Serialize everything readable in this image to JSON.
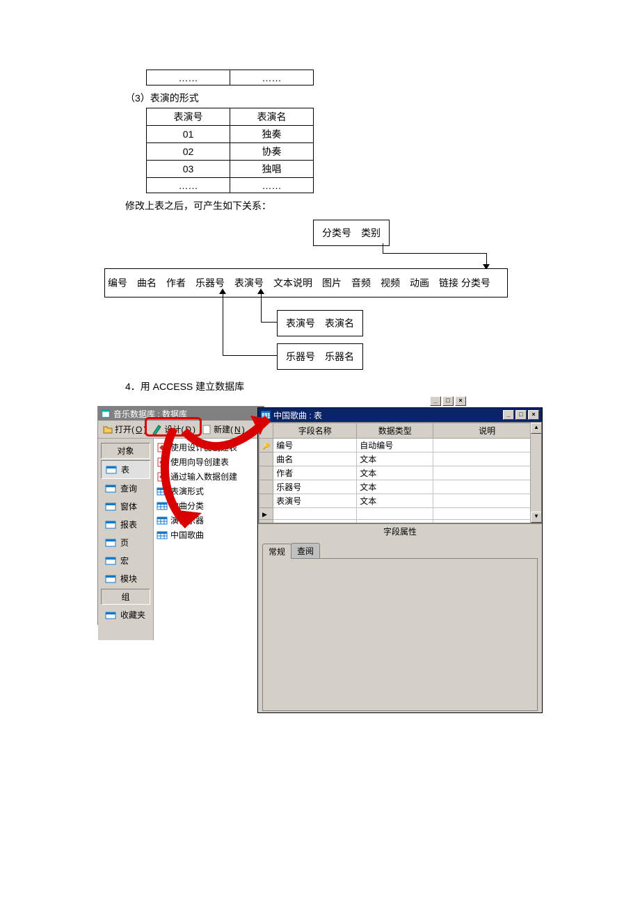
{
  "section3_title": "（3）表演的形式",
  "table0": {
    "rows": [
      [
        "……",
        "……"
      ]
    ]
  },
  "table3": {
    "headers": [
      "表演号",
      "表演名"
    ],
    "rows": [
      [
        "01",
        "独奏"
      ],
      [
        "02",
        "协奏"
      ],
      [
        "03",
        "独唱"
      ],
      [
        "……",
        "……"
      ]
    ]
  },
  "after_table_text": "修改上表之后，可产生如下关系：",
  "diagram": {
    "box_category": "分类号　类别",
    "box_main": "编号　曲名　作者　乐器号　表演号　文本说明　图片　音频　视频　动画　链接 分类号",
    "box_perform": "表演号　表演名",
    "box_instrument": "乐器号　乐器名"
  },
  "step4_title": "4．用 ACCESS 建立数据库",
  "db_window": {
    "title": "音乐数据库 : 数据库",
    "toolbar": {
      "open": "打开(",
      "open_key": "O",
      "open_tail": ")",
      "design": "设计(",
      "design_key": "D",
      "design_tail": ")",
      "new": "新建(",
      "new_key": "N",
      "new_tail": ")"
    },
    "sidebar": {
      "header_obj": "对象",
      "items": [
        {
          "label": "表",
          "selected": true
        },
        {
          "label": "查询"
        },
        {
          "label": "窗体"
        },
        {
          "label": "报表"
        },
        {
          "label": "页"
        },
        {
          "label": "宏"
        },
        {
          "label": "模块"
        }
      ],
      "header_group": "组",
      "favorites": "收藏夹"
    },
    "list_items": [
      {
        "label": "使用设计器创建表",
        "wizard": true
      },
      {
        "label": "使用向导创建表",
        "wizard": true
      },
      {
        "label": "通过输入数据创建",
        "wizard": true
      },
      {
        "label": "表演形式",
        "wizard": false
      },
      {
        "label": "歌曲分类",
        "wizard": false
      },
      {
        "label": "演奏乐器",
        "wizard": false
      },
      {
        "label": "中国歌曲",
        "wizard": false
      }
    ]
  },
  "design_window": {
    "title": "中国歌曲 : 表",
    "col_headers": [
      "字段名称",
      "数据类型",
      "说明"
    ],
    "rows": [
      {
        "name": "编号",
        "type": "自动编号",
        "key": true
      },
      {
        "name": "曲名",
        "type": "文本"
      },
      {
        "name": "作者",
        "type": "文本"
      },
      {
        "name": "乐器号",
        "type": "文本"
      },
      {
        "name": "表演号",
        "type": "文本"
      },
      {
        "name": "",
        "type": "",
        "current": true
      }
    ],
    "field_props_title": "字段属性",
    "tabs": [
      "常规",
      "查阅"
    ]
  }
}
